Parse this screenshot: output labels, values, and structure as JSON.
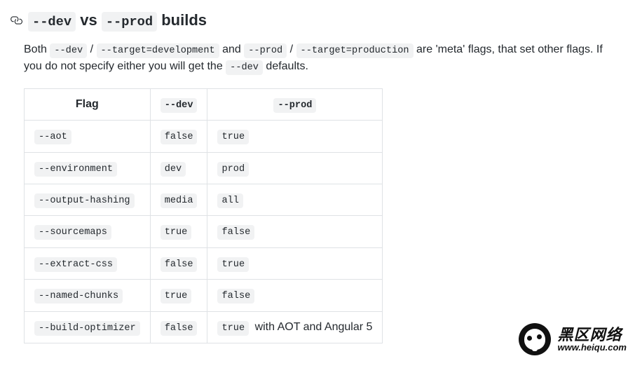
{
  "heading": {
    "code1": "--dev",
    "vs": "vs",
    "code2": "--prod",
    "tail": "builds"
  },
  "paragraph": {
    "t1": "Both ",
    "c1": "--dev",
    "t2": " / ",
    "c2": "--target=development",
    "t3": " and ",
    "c3": "--prod",
    "t4": " / ",
    "c4": "--target=production",
    "t5": " are 'meta' flags, that set other flags. If you do not specify either you will get the ",
    "c5": "--dev",
    "t6": " defaults."
  },
  "table": {
    "headers": {
      "flag": "Flag",
      "dev": "--dev",
      "prod": "--prod"
    },
    "rows": [
      {
        "flag": "--aot",
        "dev": "false",
        "prod": "true",
        "suffix": ""
      },
      {
        "flag": "--environment",
        "dev": "dev",
        "prod": "prod",
        "suffix": ""
      },
      {
        "flag": "--output-hashing",
        "dev": "media",
        "prod": "all",
        "suffix": ""
      },
      {
        "flag": "--sourcemaps",
        "dev": "true",
        "prod": "false",
        "suffix": ""
      },
      {
        "flag": "--extract-css",
        "dev": "false",
        "prod": "true",
        "suffix": ""
      },
      {
        "flag": "--named-chunks",
        "dev": "true",
        "prod": "false",
        "suffix": ""
      },
      {
        "flag": "--build-optimizer",
        "dev": "false",
        "prod": "true",
        "suffix": "with AOT and Angular 5"
      }
    ]
  },
  "watermark": {
    "big": "黑区网络",
    "small": "www.heiqu.com"
  }
}
